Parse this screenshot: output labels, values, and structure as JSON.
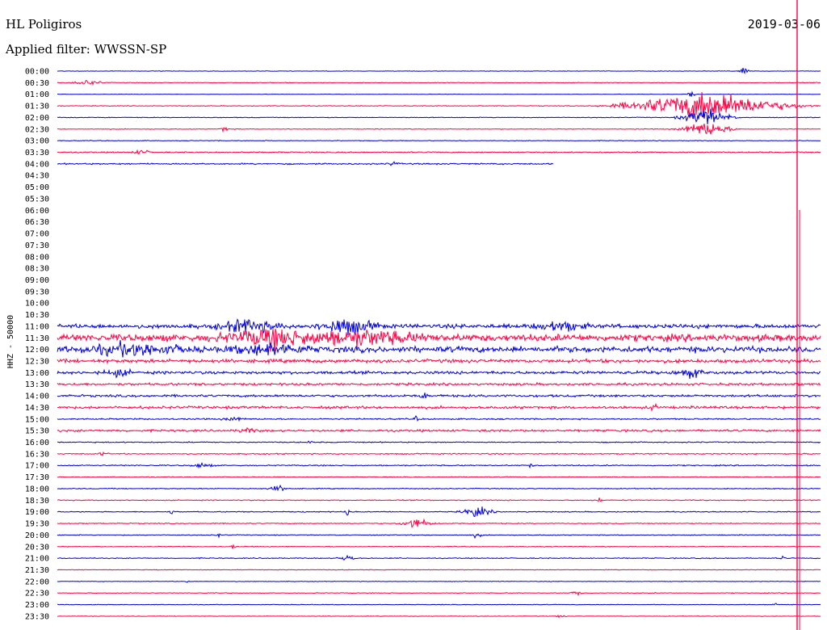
{
  "header": {
    "station": "HL Poligiros",
    "date": "2019-03-06",
    "filter_label": "Applied filter: WWSSN-SP"
  },
  "chart_data": {
    "type": "line",
    "title": "HL Poligiros",
    "subtitle": "Applied filter: WWSSN-SP",
    "ylabel": "HHZ - 50000",
    "xlabel": "",
    "legend": "none",
    "grid": false,
    "colors": {
      "even": "#0000dd",
      "odd": "#ff0044"
    },
    "row_labels": [
      "00:00",
      "00:30",
      "01:00",
      "01:30",
      "02:00",
      "02:30",
      "03:00",
      "03:30",
      "04:00",
      "04:30",
      "05:00",
      "05:30",
      "06:00",
      "06:30",
      "07:00",
      "07:30",
      "08:00",
      "08:30",
      "09:00",
      "09:30",
      "10:00",
      "10:30",
      "11:00",
      "11:30",
      "12:00",
      "12:30",
      "13:00",
      "13:30",
      "14:00",
      "14:30",
      "15:00",
      "15:30",
      "16:00",
      "16:30",
      "17:00",
      "17:30",
      "18:00",
      "18:30",
      "19:00",
      "19:30",
      "20:00",
      "20:30",
      "21:00",
      "21:30",
      "22:00",
      "22:30",
      "23:00",
      "23:30"
    ],
    "rows": [
      {
        "time": "00:00",
        "status": "recorded",
        "noise": 0.4,
        "events": [
          {
            "at": 0.9,
            "amp": 8,
            "dur": 0.01
          }
        ]
      },
      {
        "time": "00:30",
        "status": "recorded",
        "noise": 0.6,
        "events": [
          {
            "at": 0.04,
            "amp": 5,
            "dur": 0.03
          }
        ]
      },
      {
        "time": "01:00",
        "status": "recorded",
        "noise": 0.4,
        "events": [
          {
            "at": 0.83,
            "amp": 5,
            "dur": 0.01
          }
        ]
      },
      {
        "time": "01:30",
        "status": "recorded",
        "noise": 0.6,
        "events": [
          {
            "at": 0.85,
            "amp": 26,
            "dur": 0.16
          }
        ]
      },
      {
        "time": "02:00",
        "status": "recorded",
        "noise": 0.6,
        "events": [
          {
            "at": 0.85,
            "amp": 16,
            "dur": 0.05
          }
        ]
      },
      {
        "time": "02:30",
        "status": "recorded",
        "noise": 0.6,
        "events": [
          {
            "at": 0.22,
            "amp": 5,
            "dur": 0.01
          },
          {
            "at": 0.85,
            "amp": 14,
            "dur": 0.05
          }
        ]
      },
      {
        "time": "03:00",
        "status": "recorded",
        "noise": 0.6,
        "events": []
      },
      {
        "time": "03:30",
        "status": "recorded",
        "noise": 1.0,
        "events": [
          {
            "at": 0.11,
            "amp": 4,
            "dur": 0.02
          }
        ]
      },
      {
        "time": "04:00",
        "status": "partial",
        "end": 0.65,
        "noise": 1.2,
        "events": [
          {
            "at": 0.44,
            "amp": 4,
            "dur": 0.01
          }
        ]
      },
      {
        "time": "04:30",
        "status": "missing"
      },
      {
        "time": "05:00",
        "status": "missing"
      },
      {
        "time": "05:30",
        "status": "missing"
      },
      {
        "time": "06:00",
        "status": "missing"
      },
      {
        "time": "06:30",
        "status": "missing"
      },
      {
        "time": "07:00",
        "status": "missing"
      },
      {
        "time": "07:30",
        "status": "missing"
      },
      {
        "time": "08:00",
        "status": "missing"
      },
      {
        "time": "08:30",
        "status": "missing"
      },
      {
        "time": "09:00",
        "status": "missing"
      },
      {
        "time": "09:30",
        "status": "missing"
      },
      {
        "time": "10:00",
        "status": "missing"
      },
      {
        "time": "10:30",
        "status": "missing"
      },
      {
        "time": "11:00",
        "status": "recorded",
        "noise": 3.5,
        "events": [
          {
            "at": 0.25,
            "amp": 12,
            "dur": 0.06
          },
          {
            "at": 0.38,
            "amp": 14,
            "dur": 0.06
          },
          {
            "at": 0.66,
            "amp": 9,
            "dur": 0.05
          }
        ]
      },
      {
        "time": "11:30",
        "status": "recorded",
        "noise": 6,
        "events": [
          {
            "at": 0.28,
            "amp": 14,
            "dur": 0.1
          },
          {
            "at": 0.4,
            "amp": 12,
            "dur": 0.12
          }
        ]
      },
      {
        "time": "12:00",
        "status": "recorded",
        "noise": 5,
        "events": [
          {
            "at": 0.1,
            "amp": 10,
            "dur": 0.1
          },
          {
            "at": 0.28,
            "amp": 9,
            "dur": 0.08
          }
        ]
      },
      {
        "time": "12:30",
        "status": "recorded",
        "noise": 3,
        "events": []
      },
      {
        "time": "13:00",
        "status": "recorded",
        "noise": 2.5,
        "events": [
          {
            "at": 0.08,
            "amp": 6,
            "dur": 0.03
          },
          {
            "at": 0.83,
            "amp": 8,
            "dur": 0.03
          }
        ]
      },
      {
        "time": "13:30",
        "status": "recorded",
        "noise": 2,
        "events": []
      },
      {
        "time": "14:00",
        "status": "recorded",
        "noise": 2,
        "events": [
          {
            "at": 0.48,
            "amp": 5,
            "dur": 0.01
          }
        ]
      },
      {
        "time": "14:30",
        "status": "recorded",
        "noise": 2.2,
        "events": [
          {
            "at": 0.78,
            "amp": 5,
            "dur": 0.01
          }
        ]
      },
      {
        "time": "15:00",
        "status": "recorded",
        "noise": 1.2,
        "events": [
          {
            "at": 0.23,
            "amp": 4,
            "dur": 0.02
          },
          {
            "at": 0.47,
            "amp": 5,
            "dur": 0.005
          }
        ]
      },
      {
        "time": "15:30",
        "status": "recorded",
        "noise": 1.8,
        "events": [
          {
            "at": 0.25,
            "amp": 4,
            "dur": 0.02
          }
        ]
      },
      {
        "time": "16:00",
        "status": "recorded",
        "noise": 0.9,
        "events": [
          {
            "at": 0.33,
            "amp": 4,
            "dur": 0.005
          }
        ]
      },
      {
        "time": "16:30",
        "status": "recorded",
        "noise": 1.0,
        "events": [
          {
            "at": 0.06,
            "amp": 3,
            "dur": 0.01
          }
        ]
      },
      {
        "time": "17:00",
        "status": "recorded",
        "noise": 1.0,
        "events": [
          {
            "at": 0.19,
            "amp": 5,
            "dur": 0.02
          },
          {
            "at": 0.62,
            "amp": 5,
            "dur": 0.005
          }
        ]
      },
      {
        "time": "17:30",
        "status": "recorded",
        "noise": 0.7,
        "events": []
      },
      {
        "time": "18:00",
        "status": "recorded",
        "noise": 0.8,
        "events": [
          {
            "at": 0.29,
            "amp": 5,
            "dur": 0.02
          }
        ]
      },
      {
        "time": "18:30",
        "status": "recorded",
        "noise": 0.8,
        "events": [
          {
            "at": 0.71,
            "amp": 5,
            "dur": 0.005
          }
        ]
      },
      {
        "time": "19:00",
        "status": "recorded",
        "noise": 0.8,
        "events": [
          {
            "at": 0.15,
            "amp": 5,
            "dur": 0.005
          },
          {
            "at": 0.38,
            "amp": 7,
            "dur": 0.005
          },
          {
            "at": 0.55,
            "amp": 10,
            "dur": 0.03
          }
        ]
      },
      {
        "time": "19:30",
        "status": "recorded",
        "noise": 0.8,
        "events": [
          {
            "at": 0.47,
            "amp": 10,
            "dur": 0.03
          }
        ]
      },
      {
        "time": "20:00",
        "status": "recorded",
        "noise": 0.7,
        "events": [
          {
            "at": 0.21,
            "amp": 5,
            "dur": 0.005
          },
          {
            "at": 0.55,
            "amp": 5,
            "dur": 0.01
          }
        ]
      },
      {
        "time": "20:30",
        "status": "recorded",
        "noise": 0.7,
        "events": [
          {
            "at": 0.23,
            "amp": 5,
            "dur": 0.005
          }
        ]
      },
      {
        "time": "21:00",
        "status": "recorded",
        "noise": 0.8,
        "events": [
          {
            "at": 0.38,
            "amp": 5,
            "dur": 0.02
          },
          {
            "at": 0.95,
            "amp": 4,
            "dur": 0.005
          }
        ]
      },
      {
        "time": "21:30",
        "status": "recorded",
        "noise": 0.5,
        "events": []
      },
      {
        "time": "22:00",
        "status": "recorded",
        "noise": 0.5,
        "events": [
          {
            "at": 0.17,
            "amp": 3,
            "dur": 0.005
          }
        ]
      },
      {
        "time": "22:30",
        "status": "recorded",
        "noise": 0.6,
        "events": [
          {
            "at": 0.68,
            "amp": 6,
            "dur": 0.01
          }
        ]
      },
      {
        "time": "23:00",
        "status": "recorded",
        "noise": 0.5,
        "events": [
          {
            "at": 0.94,
            "amp": 4,
            "dur": 0.005
          }
        ]
      },
      {
        "time": "23:30",
        "status": "recorded",
        "noise": 0.5,
        "events": [
          {
            "at": 0.66,
            "amp": 3,
            "dur": 0.01
          }
        ]
      }
    ]
  }
}
